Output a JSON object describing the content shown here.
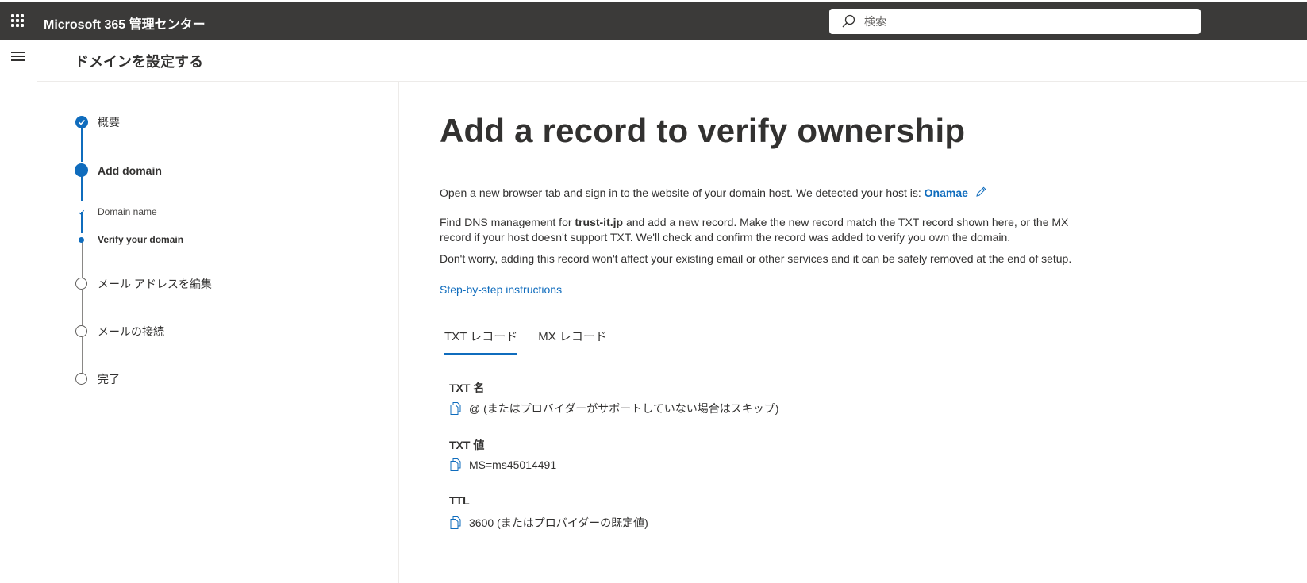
{
  "topbar": {
    "app_title": "Microsoft 365 管理センター",
    "search_placeholder": "検索"
  },
  "page_header": {
    "title": "ドメインを設定する"
  },
  "steps": [
    {
      "label": "概要",
      "state": "done"
    },
    {
      "label": "Add domain",
      "state": "active"
    },
    {
      "label": "Domain name",
      "state": "sub-done"
    },
    {
      "label": "Verify your domain",
      "state": "sub-active"
    },
    {
      "label": "メール アドレスを編集",
      "state": "todo"
    },
    {
      "label": "メールの接続",
      "state": "todo"
    },
    {
      "label": "完了",
      "state": "todo"
    }
  ],
  "main": {
    "headline": "Add a record to verify ownership",
    "p1_prefix": "Open a new browser tab and sign in to the website of your domain host. We detected your host is: ",
    "host_name": "Onamae",
    "p2_prefix": "Find DNS management for ",
    "domain": "trust-it.jp",
    "p2_suffix": " and add a new record. Make the new record match the TXT record shown here, or the MX record if your host doesn't support TXT. We'll check and confirm the record was added to verify you own the domain.",
    "p3": "Don't worry, adding this record won't affect your existing email or other services and it can be safely removed at the end of setup.",
    "instructions_link": "Step-by-step instructions",
    "tabs": [
      "TXT レコード",
      "MX レコード"
    ],
    "fields": [
      {
        "label": "TXT 名",
        "value": "@ (またはプロバイダーがサポートしていない場合はスキップ)"
      },
      {
        "label": "TXT 値",
        "value": "MS=ms45014491"
      },
      {
        "label": "TTL",
        "value": "3600 (またはプロバイダーの既定値)"
      }
    ]
  },
  "colors": {
    "topbar": "#3b3a39",
    "accent": "#0f6cbd",
    "text": "#323130"
  }
}
